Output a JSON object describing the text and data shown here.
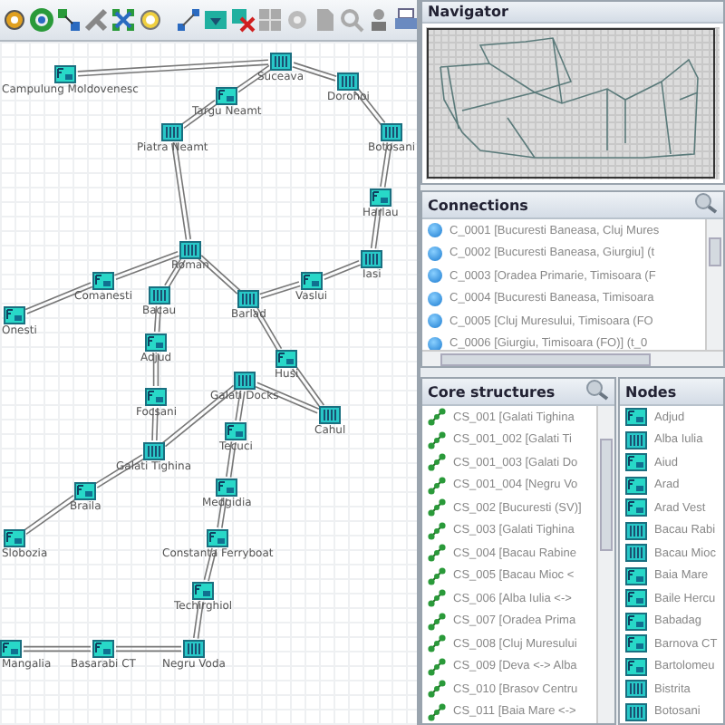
{
  "graph": {
    "nodes": [
      {
        "label": "Campulung Moldovenesc",
        "kind": "terminal"
      },
      {
        "label": "Suceava",
        "kind": "station"
      },
      {
        "label": "Dorohoi",
        "kind": "station"
      },
      {
        "label": "Targu Neamt",
        "kind": "terminal"
      },
      {
        "label": "Piatra Neamt",
        "kind": "station"
      },
      {
        "label": "Botosani",
        "kind": "station"
      },
      {
        "label": "Harlau",
        "kind": "terminal"
      },
      {
        "label": "Iasi",
        "kind": "station"
      },
      {
        "label": "Roman",
        "kind": "station"
      },
      {
        "label": "Comanesti",
        "kind": "terminal"
      },
      {
        "label": "Bacau",
        "kind": "station"
      },
      {
        "label": "Onesti",
        "kind": "terminal"
      },
      {
        "label": "Vaslui",
        "kind": "terminal"
      },
      {
        "label": "Barlad",
        "kind": "station"
      },
      {
        "label": "Adjud",
        "kind": "terminal"
      },
      {
        "label": "Husi",
        "kind": "terminal"
      },
      {
        "label": "Galati Docks",
        "kind": "station"
      },
      {
        "label": "Focsani",
        "kind": "terminal"
      },
      {
        "label": "Tecuci",
        "kind": "terminal"
      },
      {
        "label": "Cahul",
        "kind": "station"
      },
      {
        "label": "Galati Tighina",
        "kind": "station"
      },
      {
        "label": "Braila",
        "kind": "terminal"
      },
      {
        "label": "Slobozia",
        "kind": "terminal"
      },
      {
        "label": "Medgidia",
        "kind": "terminal"
      },
      {
        "label": "Constanta Ferryboat",
        "kind": "terminal"
      },
      {
        "label": "Techirghiol",
        "kind": "terminal"
      },
      {
        "label": "Mangalia",
        "kind": "terminal"
      },
      {
        "label": "Basarabi CT",
        "kind": "terminal"
      },
      {
        "label": "Negru Voda",
        "kind": "station"
      }
    ]
  },
  "navigator": {
    "title": "Navigator"
  },
  "connections": {
    "title": "Connections",
    "items": [
      "C_0001 [Bucuresti Baneasa, Cluj Mures",
      "C_0002 [Bucuresti Baneasa, Giurgiu] (t",
      "C_0003 [Oradea Primarie, Timisoara (F",
      "C_0004 [Bucuresti Baneasa, Timisoara",
      "C_0005 [Cluj Muresului, Timisoara (FO",
      "C_0006 [Giurgiu, Timisoara (FO)] (t_0"
    ]
  },
  "core": {
    "title": "Core structures",
    "items": [
      "CS_001 [Galati Tighina",
      "CS_001_002 [Galati Ti",
      "CS_001_003 [Galati Do",
      "CS_001_004 [Negru Vo",
      "CS_002 [Bucuresti (SV)]",
      "CS_003 [Galati Tighina",
      "CS_004 [Bacau Rabine",
      "CS_005 [Bacau Mioc <",
      "CS_006 [Alba Iulia <->",
      "CS_007 [Oradea Prima",
      "CS_008 [Cluj Muresului",
      "CS_009 [Deva <-> Alba",
      "CS_010 [Brasov Centru",
      "CS_011 [Baia Mare <->"
    ]
  },
  "nodes_panel": {
    "title": "Nodes",
    "items": [
      {
        "label": "Adjud",
        "kind": "terminal"
      },
      {
        "label": "Alba Iulia",
        "kind": "station"
      },
      {
        "label": "Aiud",
        "kind": "terminal"
      },
      {
        "label": "Arad",
        "kind": "terminal"
      },
      {
        "label": "Arad Vest",
        "kind": "terminal"
      },
      {
        "label": "Bacau Rabi",
        "kind": "station"
      },
      {
        "label": "Bacau Mioc",
        "kind": "station"
      },
      {
        "label": "Baia Mare",
        "kind": "terminal"
      },
      {
        "label": "Baile Hercu",
        "kind": "terminal"
      },
      {
        "label": "Babadag",
        "kind": "terminal"
      },
      {
        "label": "Barnova CT",
        "kind": "terminal"
      },
      {
        "label": "Bartolomeu",
        "kind": "terminal"
      },
      {
        "label": "Bistrita",
        "kind": "station"
      },
      {
        "label": "Botosani",
        "kind": "station"
      }
    ]
  }
}
